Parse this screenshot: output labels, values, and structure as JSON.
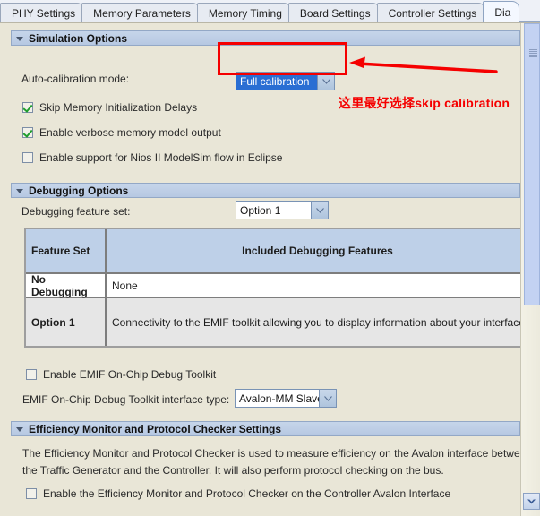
{
  "tabs": [
    {
      "label": "PHY Settings",
      "selected": false
    },
    {
      "label": "Memory Parameters",
      "selected": false
    },
    {
      "label": "Memory Timing",
      "selected": false
    },
    {
      "label": "Board Settings",
      "selected": false
    },
    {
      "label": "Controller Settings",
      "selected": false
    },
    {
      "label": "Dia",
      "selected": true
    }
  ],
  "simulation_options": {
    "header": "Simulation Options",
    "autocal_label": "Auto-calibration mode:",
    "autocal_value": "Full calibration",
    "checkboxes": [
      {
        "label": "Skip Memory Initialization Delays",
        "checked": true
      },
      {
        "label": "Enable verbose memory model output",
        "checked": true
      },
      {
        "label": "Enable support for Nios II ModelSim flow in Eclipse",
        "checked": false
      }
    ]
  },
  "debugging_options": {
    "header": "Debugging Options",
    "feature_set_label": "Debugging feature set:",
    "feature_set_value": "Option 1",
    "table": {
      "columns": [
        "Feature Set",
        "Included Debugging Features"
      ],
      "rows": [
        [
          "No Debugging",
          "None"
        ],
        [
          "Option 1",
          "Connectivity to the EMIF toolkit allowing you to display information about your interface"
        ]
      ]
    },
    "emif_checkbox": {
      "label": "Enable EMIF On-Chip Debug Toolkit",
      "checked": false
    },
    "interface_type_label": "EMIF On-Chip Debug Toolkit interface type:",
    "interface_type_value": "Avalon-MM Slave"
  },
  "efficiency_monitor": {
    "header": "Efficiency Monitor and Protocol Checker Settings",
    "desc_line1": "The Efficiency Monitor and Protocol Checker is used to measure efficiency on the Avalon interface betwe",
    "desc_line2": "the Traffic Generator and the Controller. It will also perform protocol checking on the bus.",
    "checkbox": {
      "label": "Enable the Efficiency Monitor and Protocol Checker on the Controller Avalon Interface",
      "checked": false
    }
  },
  "annotation": {
    "text": "这里最好选择skip calibration",
    "color": "#f50000"
  },
  "colors": {
    "panel_bg": "#e9e6d7",
    "section_header": "#bccde6",
    "accent_blue": "#2a6ed3",
    "check_green": "#1f9e2e"
  }
}
